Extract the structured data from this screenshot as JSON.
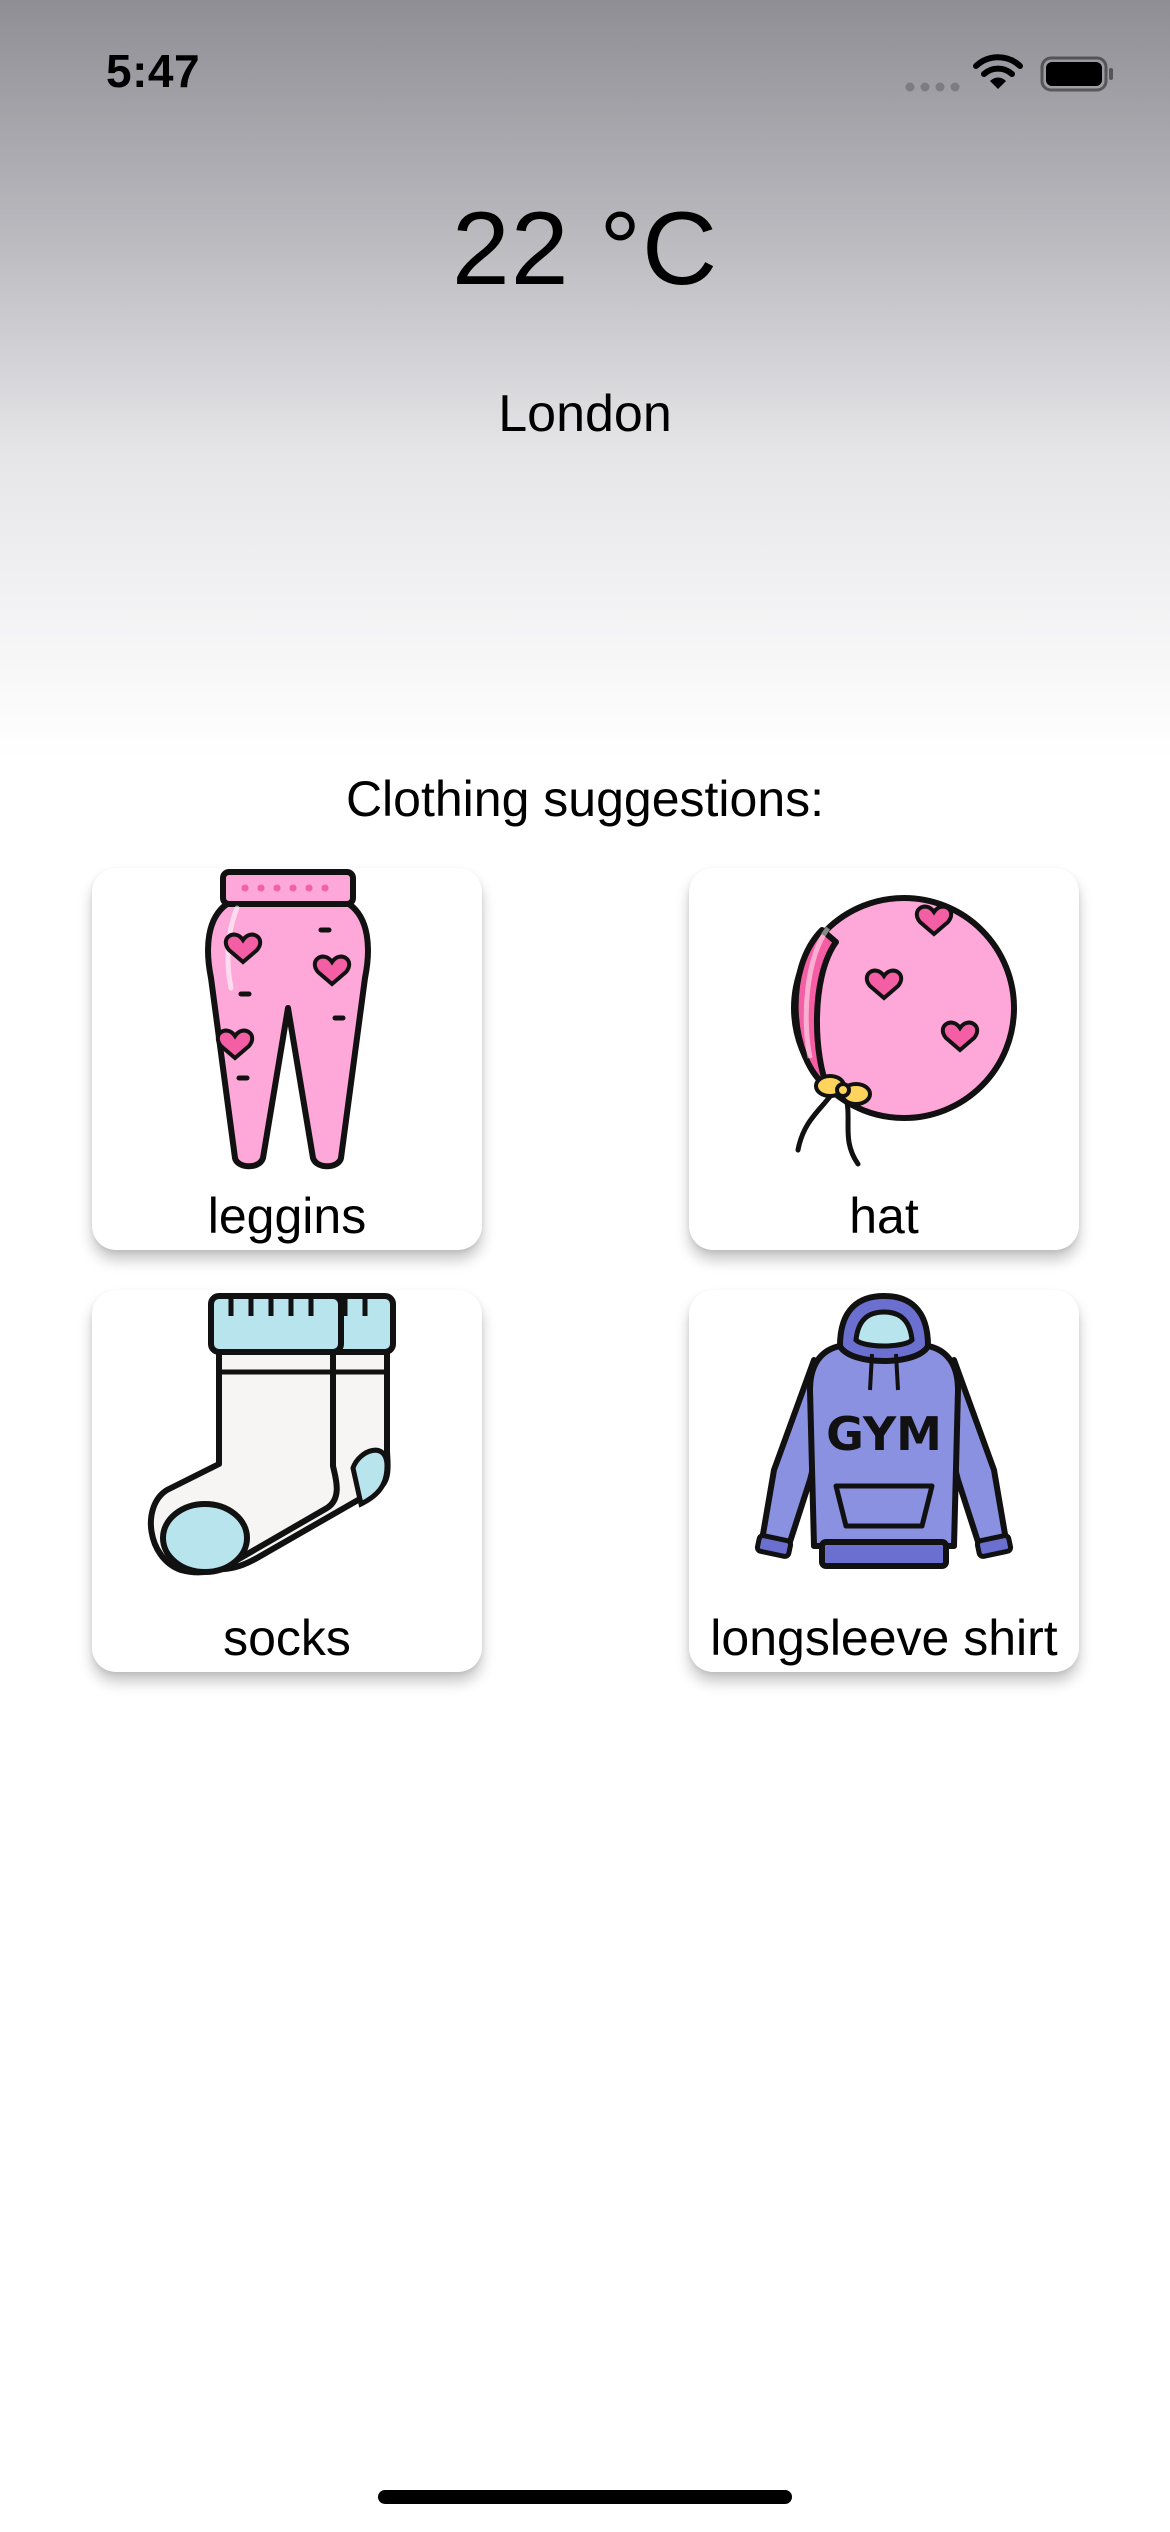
{
  "status_bar": {
    "time": "5:47",
    "icons": [
      "signal-dots-icon",
      "wifi-icon",
      "battery-icon"
    ]
  },
  "weather": {
    "temperature": "22 °C",
    "city": "London"
  },
  "suggestions": {
    "title": "Clothing suggestions:",
    "items": [
      {
        "label": "leggins",
        "icon": "leggings-icon"
      },
      {
        "label": "hat",
        "icon": "bonnet-hat-icon"
      },
      {
        "label": "socks",
        "icon": "socks-icon"
      },
      {
        "label": "longsleeve shirt",
        "icon": "hoodie-icon",
        "print": "GYM"
      }
    ]
  },
  "colors": {
    "background_top": "#8f8e94",
    "background_bottom": "#ffffff",
    "pink": "#fda8d9",
    "heart_pink": "#f45ea4",
    "light_blue": "#b8e4ee",
    "hoodie_blue": "#8a91e0",
    "hoodie_dark": "#6b6fcf",
    "tie_yellow": "#ffd45c"
  }
}
